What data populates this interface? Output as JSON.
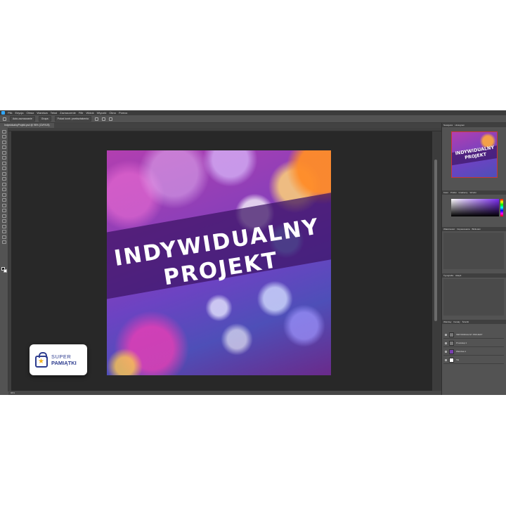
{
  "app": {
    "menu": [
      "Plik",
      "Edycja",
      "Obraz",
      "Warstwa",
      "Tekst",
      "Zaznaczenie",
      "Filtr",
      "Widok",
      "Wtyczki",
      "Okno",
      "Pomoc"
    ],
    "document_tab": "IndywidualnyProjekt.psd @ 96% (CMYK/8)",
    "status": "96%"
  },
  "options": {
    "auto_select": "Auto-zaznaczanie",
    "target": "Grupa",
    "show_controls": "Pokaż kontr. przekształcenia"
  },
  "canvas": {
    "headline_line1": "INDYWIDUALNY",
    "headline_line2": "PROJEKT"
  },
  "panels": {
    "navigator_tabs": [
      "Nawigator",
      "Histogram"
    ],
    "navigator_zoom": "96%",
    "navigator_thumb_line1": "INDYWIDUALNY",
    "navigator_thumb_line2": "PROJEKT",
    "color_tabs": [
      "Kolor",
      "Próbki",
      "Gradienty",
      "Wzorki"
    ],
    "properties_tabs": [
      "Właściwości",
      "Dopasowania",
      "Biblioteki"
    ],
    "character_tabs": [
      "Typografia",
      "Akapit"
    ],
    "layers_tabs": [
      "Warstwy",
      "Kanały",
      "Ścieżki"
    ],
    "layers": [
      "INDYWIDUALNY PROJEKT",
      "Prostokąt 1",
      "Warstwa 1",
      "Tło"
    ]
  },
  "watermark": {
    "brand_top": "SUPER",
    "brand_bottom": "PAMIĄTKI"
  },
  "colors": {
    "accent": "#31a8ff",
    "brand": "#2d3c8f",
    "brand_star": "#f5b21a"
  }
}
